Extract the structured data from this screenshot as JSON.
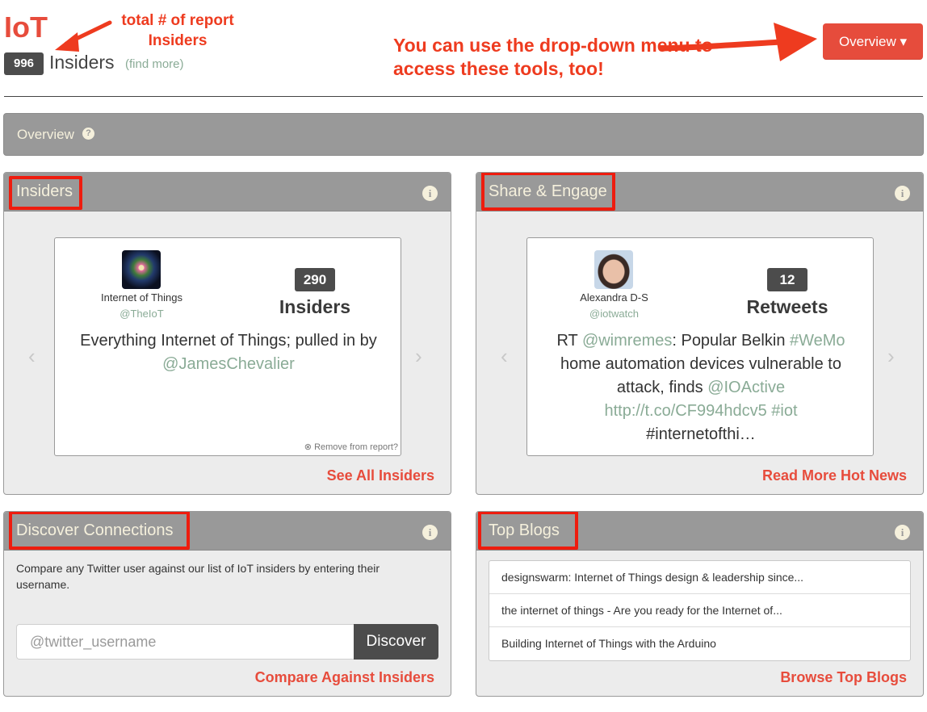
{
  "header": {
    "brand": "IoT",
    "insider_count": "996",
    "insiders_word": "Insiders",
    "find_more": "(find more)",
    "overview_button": "Overview ▾"
  },
  "annotations": {
    "total": "total # of report Insiders",
    "dropdown": "You can use the drop-down menu to access these tools, too!"
  },
  "overview_bar": {
    "label": "Overview",
    "help_icon": "?"
  },
  "panels": {
    "insiders": {
      "title": "Insiders",
      "info_icon": "i",
      "profile_name": "Internet of Things",
      "profile_handle": "@TheIoT",
      "stat_value": "290",
      "stat_label": "Insiders",
      "text_plain": "Everything Internet of Things; pulled in by",
      "text_mention": "@JamesChevalier",
      "remove": "⊗ Remove from report?",
      "prev": "‹",
      "next": "›",
      "link": "See All Insiders"
    },
    "share": {
      "title": "Share & Engage",
      "info_icon": "i",
      "profile_name": "Alexandra D-S",
      "profile_handle": "@iotwatch",
      "stat_value": "12",
      "stat_label": "Retweets",
      "t1": "RT ",
      "t2": "@wimremes",
      "t3": ": Popular Belkin ",
      "t4": "#WeMo",
      "t5": "home automation devices vulnerable to",
      "t6": "attack, finds ",
      "t7": "@IOActive",
      "t8": "http://t.co/CF994hdcv5",
      "t9": " #iot",
      "t10": "#internetofthi…",
      "prev": "‹",
      "next": "›",
      "link": "Read More Hot News"
    },
    "discover": {
      "title": "Discover Connections",
      "info_icon": "i",
      "description": "Compare any Twitter user against our list of IoT insiders by entering their username.",
      "input_placeholder": "@twitter_username",
      "button": "Discover",
      "link": "Compare Against Insiders"
    },
    "blogs": {
      "title": "Top Blogs",
      "info_icon": "i",
      "items": [
        "designswarm: Internet of Things design & leadership since...",
        "the internet of things - Are you ready for the Internet of...",
        "Building Internet of Things with the Arduino"
      ],
      "link": "Browse Top Blogs"
    }
  }
}
